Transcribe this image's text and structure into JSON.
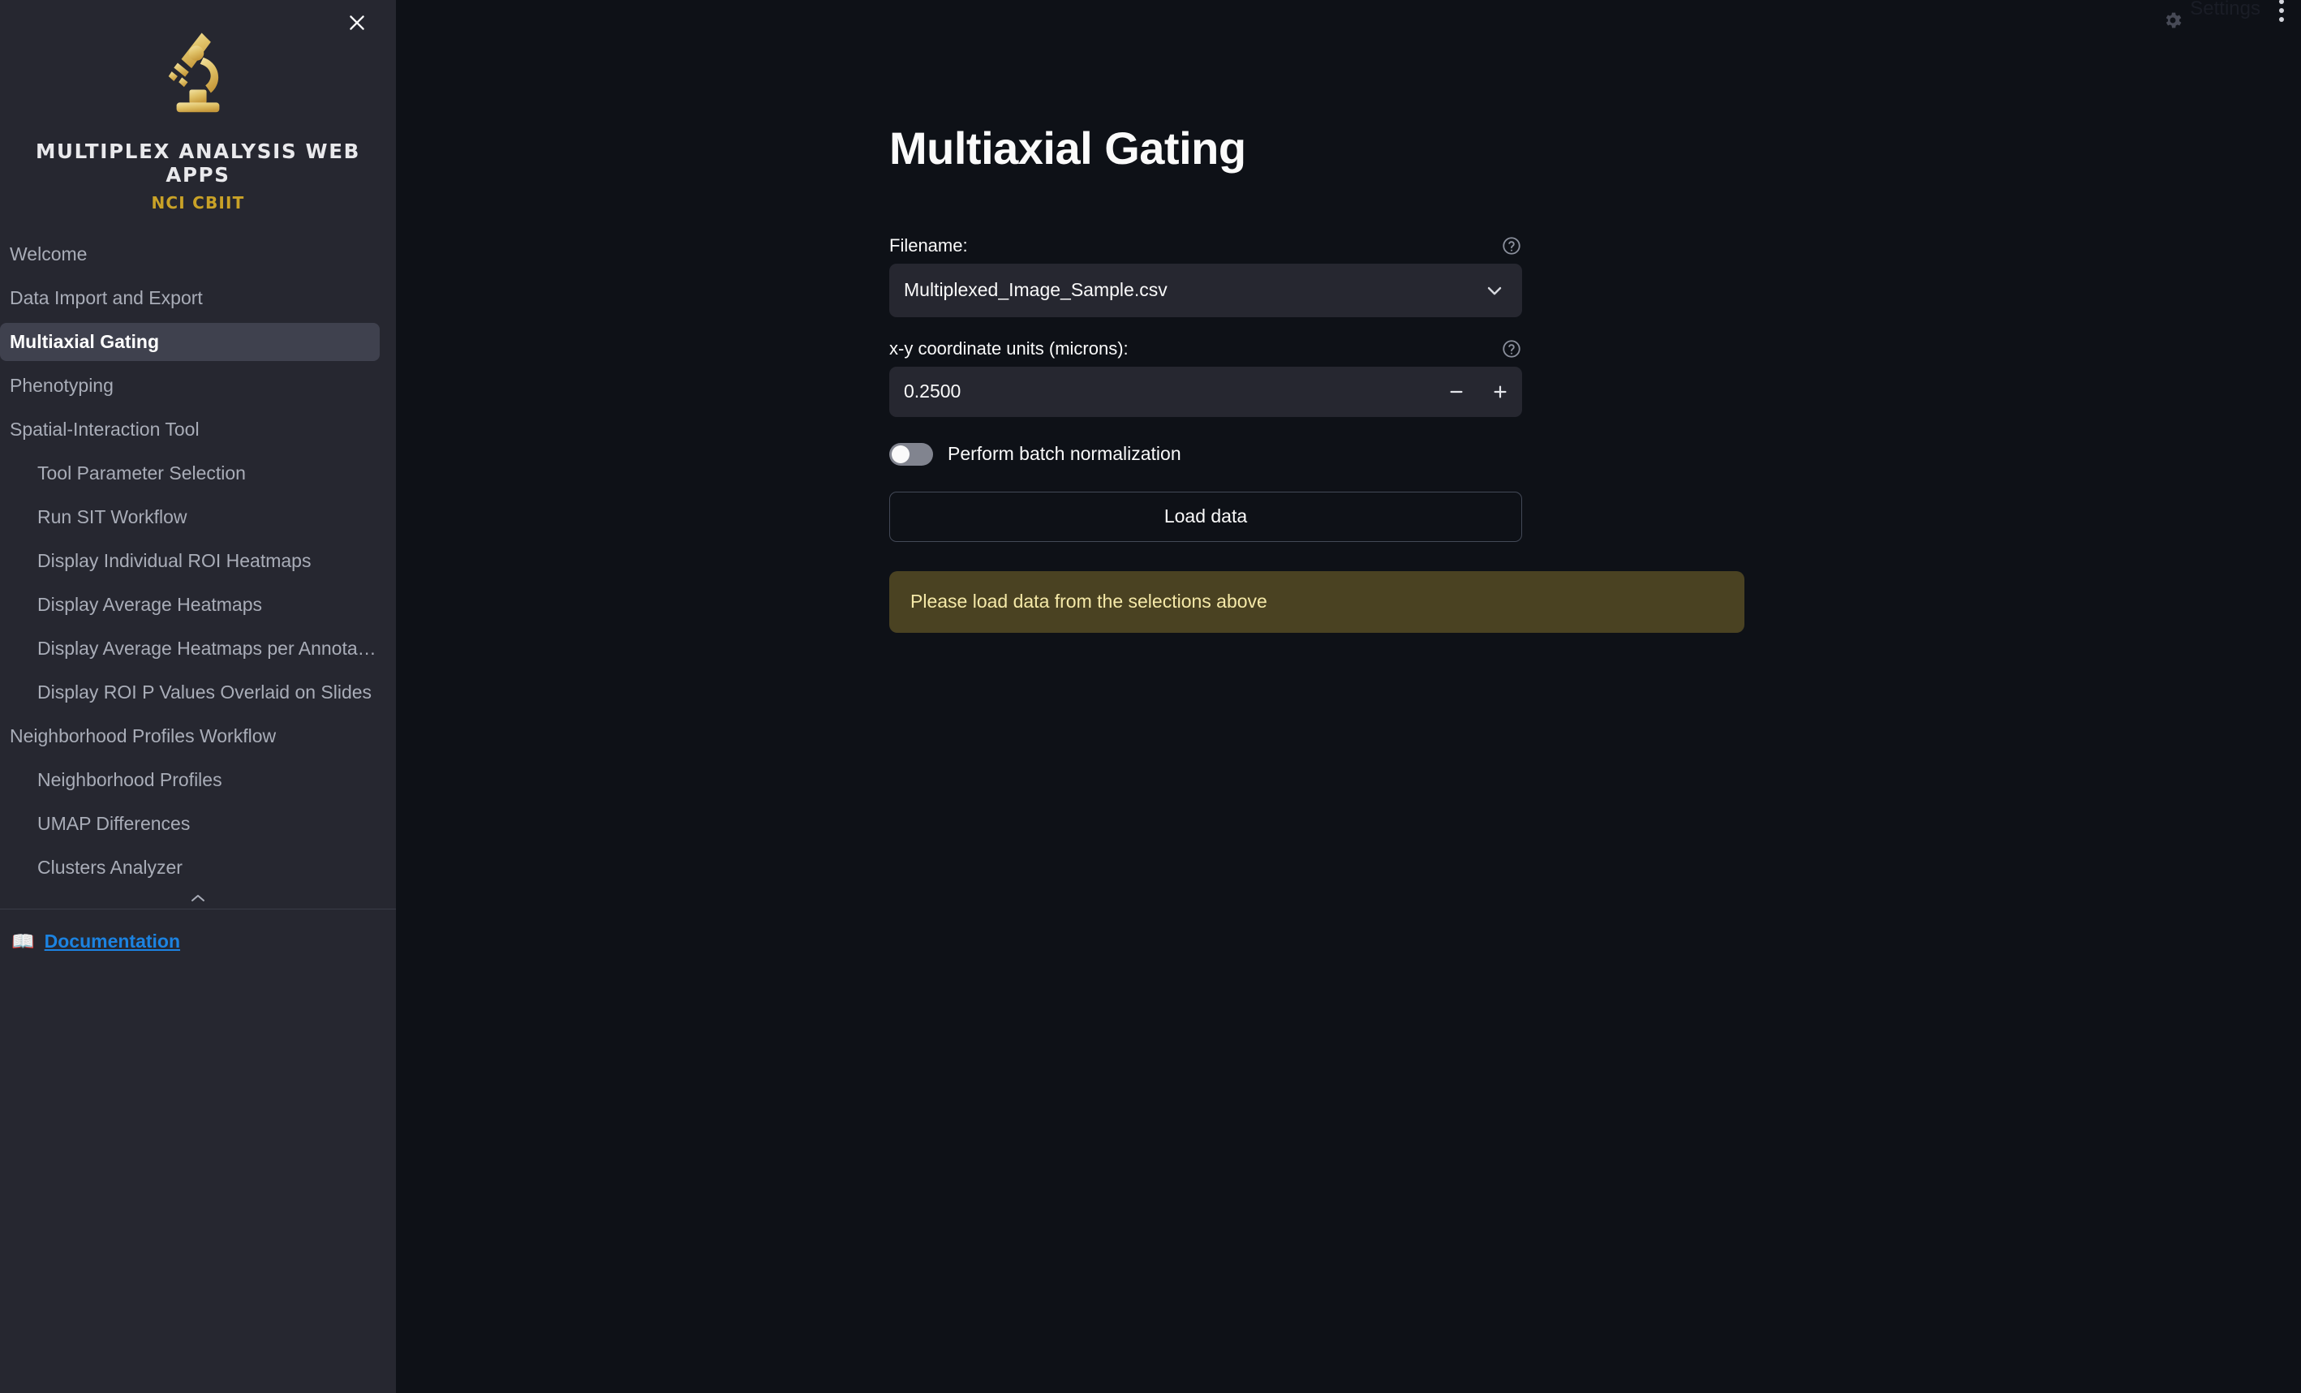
{
  "sidebar": {
    "close_icon": "close-icon",
    "logo": {
      "icon": "microscope-icon",
      "title": "MULTIPLEX ANALYSIS WEB APPS",
      "subtitle": "NCI CBIIT",
      "color": "#c9a227"
    },
    "nav": [
      {
        "label": "Welcome",
        "level": 0,
        "active": false
      },
      {
        "label": "Data Import and Export",
        "level": 0,
        "active": false
      },
      {
        "label": "Multiaxial Gating",
        "level": 0,
        "active": true
      },
      {
        "label": "Phenotyping",
        "level": 0,
        "active": false
      },
      {
        "label": "Spatial-Interaction Tool",
        "level": 0,
        "active": false
      },
      {
        "label": "Tool Parameter Selection",
        "level": 1,
        "active": false
      },
      {
        "label": "Run SIT Workflow",
        "level": 1,
        "active": false
      },
      {
        "label": "Display Individual ROI Heatmaps",
        "level": 1,
        "active": false
      },
      {
        "label": "Display Average Heatmaps",
        "level": 1,
        "active": false
      },
      {
        "label": "Display Average Heatmaps per Annota…",
        "level": 1,
        "active": false
      },
      {
        "label": "Display ROI P Values Overlaid on Slides",
        "level": 1,
        "active": false
      },
      {
        "label": "Neighborhood Profiles Workflow",
        "level": 0,
        "active": false
      },
      {
        "label": "Neighborhood Profiles",
        "level": 1,
        "active": false
      },
      {
        "label": "UMAP Differences",
        "level": 1,
        "active": false
      },
      {
        "label": "Clusters Analyzer",
        "level": 1,
        "active": false
      }
    ],
    "collapse_icon": "chevron-up-icon",
    "documentation": {
      "icon": "open-book-icon",
      "label": "Documentation",
      "color": "#1c83e1"
    },
    "active_bg": "#3f414e",
    "bg": "#262730"
  },
  "topbar": {
    "gear_icon": "gear-icon",
    "settings_label": "Settings",
    "menu_icon": "kebab-menu-icon"
  },
  "main": {
    "title": "Multiaxial Gating",
    "filename_field": {
      "label": "Filename:",
      "value": "Multiplexed_Image_Sample.csv",
      "help_icon": "help-circle-icon",
      "chevron_icon": "chevron-down-icon"
    },
    "units_field": {
      "label": "x-y coordinate units (microns):",
      "value": "0.2500",
      "help_icon": "help-circle-icon",
      "decrement_icon": "minus-icon",
      "increment_icon": "plus-icon"
    },
    "batch_toggle": {
      "label": "Perform batch normalization",
      "checked": false
    },
    "load_button": {
      "label": "Load data"
    },
    "alert": {
      "text": "Please load data from the selections above",
      "bg": "#4a4222",
      "color": "#f5e9a8"
    }
  }
}
